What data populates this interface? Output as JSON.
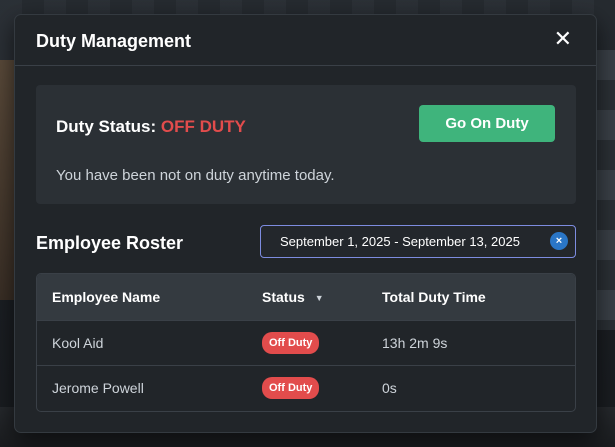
{
  "modal": {
    "title": "Duty Management",
    "close_glyph": "✕"
  },
  "status": {
    "label": "Duty Status:",
    "value": "OFF DUTY",
    "value_color": "#e24c4c",
    "go_button": "Go On Duty",
    "note": "You have been not on duty anytime today."
  },
  "roster": {
    "title": "Employee Roster",
    "date_range": "September 1, 2025 - September 13, 2025",
    "clear_glyph": "×",
    "columns": [
      "Employee Name",
      "Status",
      "Total Duty Time"
    ],
    "sort_glyph": "▼",
    "rows": [
      {
        "name": "Kool Aid",
        "status": "Off Duty",
        "time": "13h 2m 9s"
      },
      {
        "name": "Jerome Powell",
        "status": "Off Duty",
        "time": "0s"
      }
    ]
  },
  "colors": {
    "accent_green": "#3fb47c",
    "off_duty_red": "#e24c4c",
    "clear_blue": "#2a76c7"
  }
}
